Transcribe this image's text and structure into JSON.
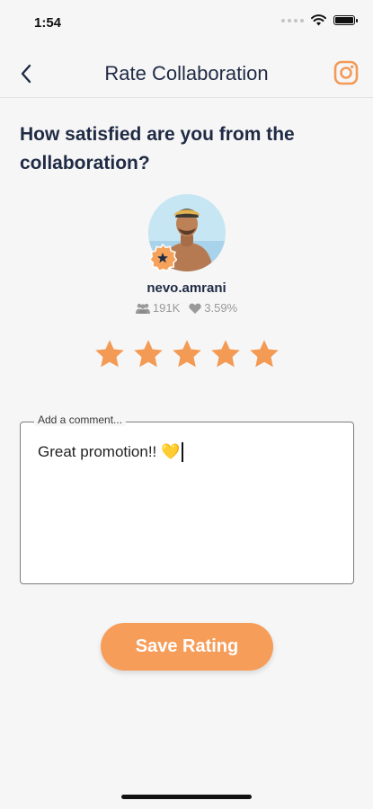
{
  "status_bar": {
    "time": "1:54"
  },
  "nav": {
    "title": "Rate Collaboration"
  },
  "question": "How satisfied are you from the collaboration?",
  "influencer": {
    "username": "nevo.amrani",
    "followers": "191K",
    "engagement": "3.59%"
  },
  "rating": {
    "value": 5,
    "max": 5
  },
  "comment": {
    "label": "Add a comment...",
    "value": "Great promotion!! 💛"
  },
  "save_label": "Save Rating",
  "colors": {
    "accent": "#f79d5a",
    "star": "#f39a54",
    "title_text": "#1f2a44",
    "instagram": "#f29a58"
  },
  "icons": {
    "back": "chevron-left-icon",
    "instagram": "instagram-icon",
    "followers": "users-icon",
    "engagement": "heart-icon",
    "badge": "star-badge-icon"
  }
}
